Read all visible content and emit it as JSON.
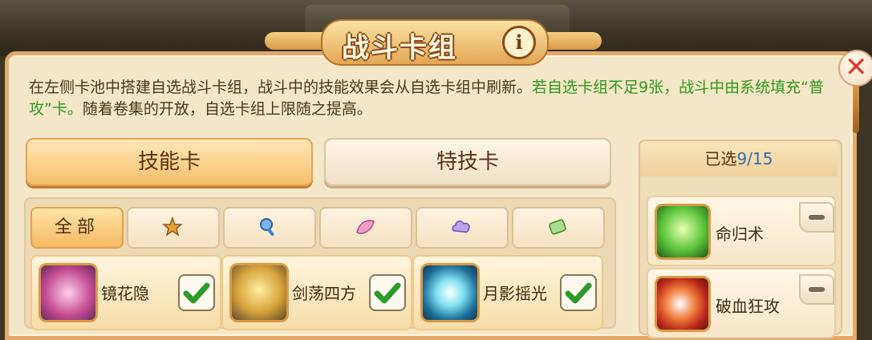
{
  "title": "战斗卡组",
  "info_label": "i",
  "close_label": "✕",
  "description": {
    "normal": "在左侧卡池中搭建自选战斗卡组，战斗中的技能效果会从自选卡组中刷新。",
    "highlight": "若自选卡组不足9张，战斗中由系统填充“普攻”卡。",
    "tail": "随着卷集的开放，自选卡组上限随之提高。"
  },
  "tabs": [
    {
      "label": "技能卡",
      "active": true
    },
    {
      "label": "特技卡",
      "active": false
    }
  ],
  "filters": [
    {
      "label": "全部",
      "icon": "all",
      "active": true
    },
    {
      "label": "",
      "icon": "star-fist-icon",
      "color": "#e7a23a"
    },
    {
      "label": "",
      "icon": "key-icon",
      "color": "#3d7fd0"
    },
    {
      "label": "",
      "icon": "leaf-icon",
      "color": "#d764a8"
    },
    {
      "label": "",
      "icon": "cloud-icon",
      "color": "#8d6ac7"
    },
    {
      "label": "",
      "icon": "scroll-icon",
      "color": "#49a441"
    }
  ],
  "cards": [
    {
      "name": "镜花隐",
      "checked": true,
      "icon": "lotus-icon"
    },
    {
      "name": "剑荡四方",
      "checked": true,
      "icon": "swords-icon"
    },
    {
      "name": "月影摇光",
      "checked": true,
      "icon": "moonlight-icon"
    }
  ],
  "selected": {
    "label": "已选",
    "count": "9/15",
    "items": [
      {
        "name": "命归术",
        "icon": "green-spirit-icon"
      },
      {
        "name": "破血狂攻",
        "icon": "blade-strike-icon"
      }
    ]
  },
  "colors": {
    "accent": "#e2a96a",
    "highlight_text": "#2f9a1c",
    "count_text": "#2e6fb0",
    "close_red": "#d83a2c"
  }
}
